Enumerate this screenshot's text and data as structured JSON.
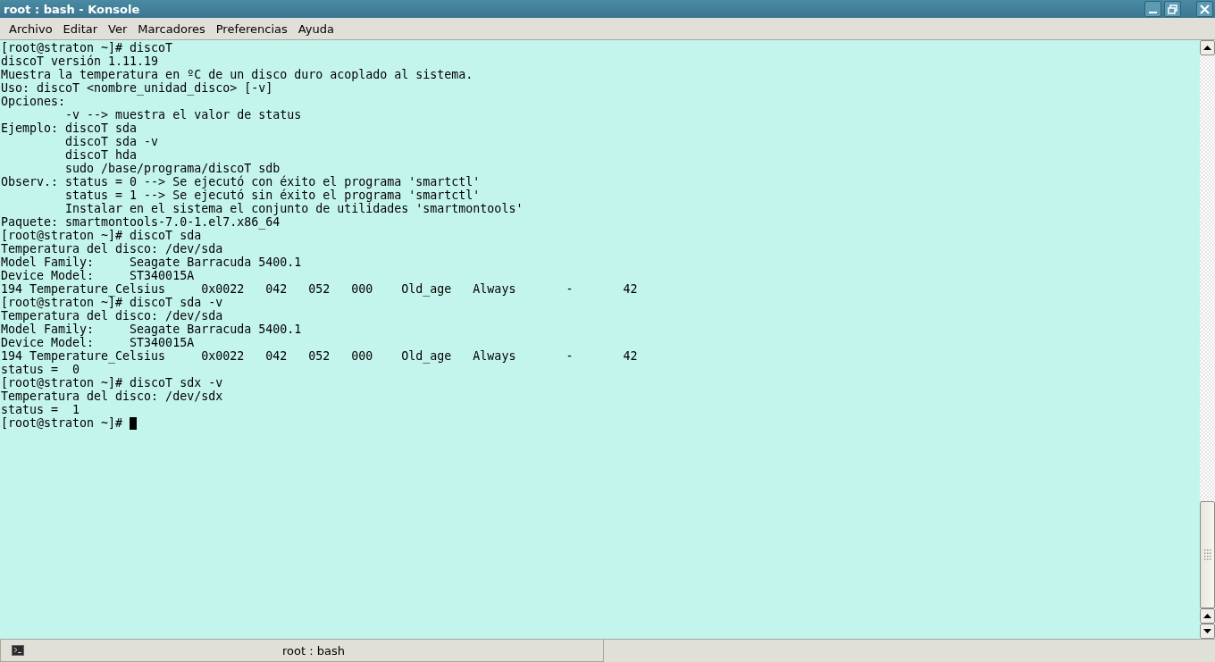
{
  "window": {
    "title": "root : bash - Konsole"
  },
  "menu": [
    "Archivo",
    "Editar",
    "Ver",
    "Marcadores",
    "Preferencias",
    "Ayuda"
  ],
  "terminal": {
    "lines": [
      "[root@straton ~]# discoT",
      "discoT versión 1.11.19",
      "Muestra la temperatura en ºC de un disco duro acoplado al sistema.",
      "Uso: discoT <nombre_unidad_disco> [-v]",
      "Opciones:",
      "         -v --> muestra el valor de status",
      "Ejemplo: discoT sda",
      "         discoT sda -v",
      "         discoT hda",
      "         sudo /base/programa/discoT sdb",
      "Observ.: status = 0 --> Se ejecutó con éxito el programa 'smartctl'",
      "         status = 1 --> Se ejecutó sin éxito el programa 'smartctl'",
      "         Instalar en el sistema el conjunto de utilidades 'smartmontools'",
      "Paquete: smartmontools-7.0-1.el7.x86_64",
      "[root@straton ~]# discoT sda",
      "Temperatura del disco: /dev/sda",
      "Model Family:     Seagate Barracuda 5400.1",
      "Device Model:     ST340015A",
      "194 Temperature_Celsius     0x0022   042   052   000    Old_age   Always       -       42",
      "[root@straton ~]# discoT sda -v",
      "Temperatura del disco: /dev/sda",
      "Model Family:     Seagate Barracuda 5400.1",
      "Device Model:     ST340015A",
      "194 Temperature_Celsius     0x0022   042   052   000    Old_age   Always       -       42",
      "status =  0",
      "[root@straton ~]# discoT sdx -v",
      "Temperatura del disco: /dev/sdx",
      "status =  1"
    ],
    "prompt": "[root@straton ~]#"
  },
  "tabs": [
    {
      "label": "root : bash",
      "selected": true
    }
  ]
}
